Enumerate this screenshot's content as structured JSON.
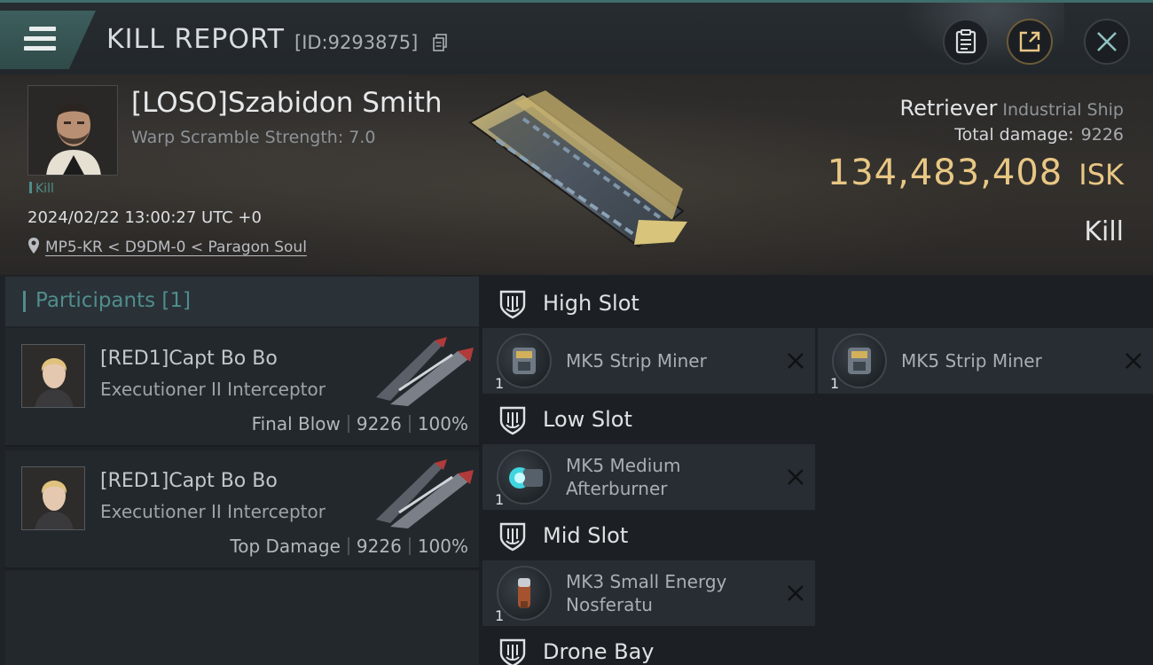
{
  "header": {
    "title": "KILL REPORT",
    "report_id": "[ID:9293875]"
  },
  "victim": {
    "name": "[LOSO]Szabidon Smith",
    "warp_text": "Warp Scramble Strength: 7.0",
    "tag": "Kill",
    "datetime": "2024/02/22 13:00:27 UTC +0",
    "location": "MP5-KR < D9DM-0 < Paragon Soul",
    "ship_name": "Retriever",
    "ship_class": "Industrial Ship",
    "total_damage_label": "Total damage:",
    "total_damage": "9226",
    "isk_value": "134,483,408",
    "isk_unit": "ISK",
    "result": "Kill"
  },
  "participants": {
    "title": "Participants [1]",
    "items": [
      {
        "name": "[RED1]Capt Bo Bo",
        "ship": "Executioner II Interceptor",
        "role": "Final Blow",
        "damage": "9226",
        "percent": "100%"
      },
      {
        "name": "[RED1]Capt Bo Bo",
        "ship": "Executioner II Interceptor",
        "role": "Top Damage",
        "damage": "9226",
        "percent": "100%"
      }
    ]
  },
  "slots": {
    "high": {
      "title": "High Slot",
      "modules": [
        {
          "name": "MK5 Strip Miner",
          "qty": "1"
        },
        {
          "name": "MK5 Strip Miner",
          "qty": "1"
        }
      ]
    },
    "low": {
      "title": "Low Slot",
      "modules": [
        {
          "name_line1": "MK5 Medium",
          "name_line2": "Afterburner",
          "qty": "1"
        }
      ]
    },
    "mid": {
      "title": "Mid Slot",
      "modules": [
        {
          "name_line1": "MK3 Small Energy",
          "name_line2": "Nosferatu",
          "qty": "1"
        }
      ]
    },
    "drone": {
      "title": "Drone Bay"
    }
  },
  "colors": {
    "accent": "#4f8d8c",
    "isk": "#e8c784",
    "share_ring": "#6d5b39"
  },
  "icons": {
    "menu": "hamburger-icon",
    "copy": "copy-icon",
    "clipboard": "clipboard-icon",
    "share": "share-icon",
    "close": "close-icon",
    "location": "location-pin-icon",
    "slot": "shield-icon",
    "destroyed": "x-icon"
  }
}
